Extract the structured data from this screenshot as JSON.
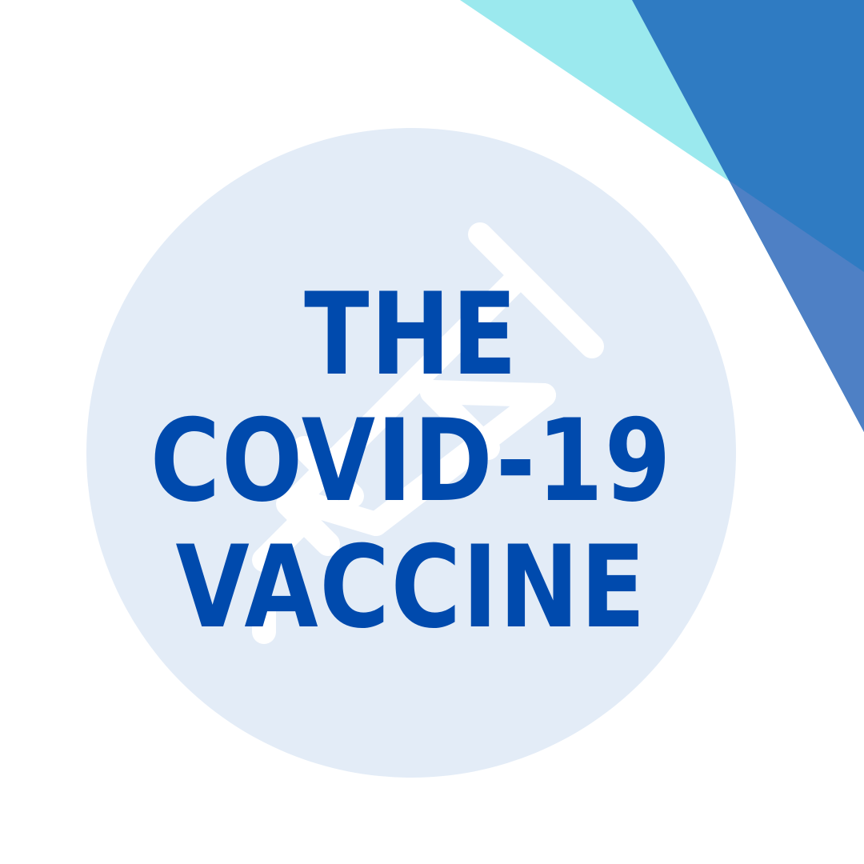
{
  "headline": {
    "lines": [
      "THE",
      "COVID-19",
      "VACCINE"
    ]
  },
  "colors": {
    "background": "#ffffff",
    "circle": "#e3ecf7",
    "text": "#004aad",
    "syringe": "#ffffff",
    "triangle_cyan": "#9be9ee",
    "triangle_blue": "#2f7bc2",
    "triangle_mid": "#4e80c5"
  },
  "icons": {
    "background_icon": "syringe-icon"
  }
}
